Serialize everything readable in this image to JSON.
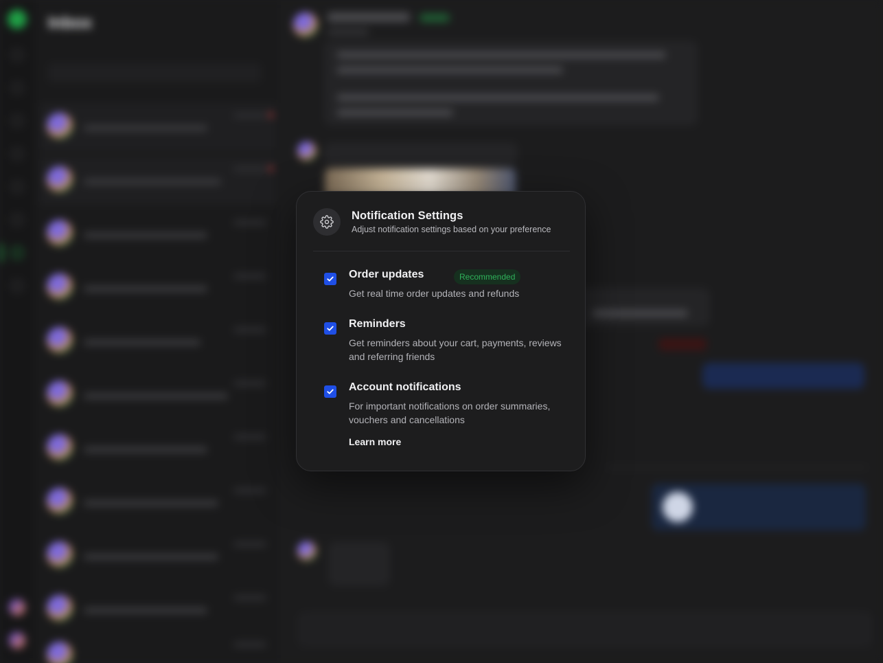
{
  "background": {
    "inbox_title": "Inbox",
    "note": ""
  },
  "modal": {
    "icon": "gear-icon",
    "title": "Notification Settings",
    "subtitle": "Adjust notification settings based on your preference",
    "options": [
      {
        "title": "Order updates",
        "badge": "Recommended",
        "description": "Get real time order updates and refunds",
        "checked": true
      },
      {
        "title": "Reminders",
        "description": "Get reminders about your cart, payments, reviews and referring friends",
        "checked": true
      },
      {
        "title": "Account notifications",
        "description": "For important notifications on order summaries, vouchers and cancellations",
        "checked": true
      }
    ],
    "learn_more": "Learn more"
  },
  "colors": {
    "checkbox": "#1f4fe6",
    "badge_text": "#2fb15a",
    "badge_bg": "#16301f",
    "modal_bg": "#1d1d1e"
  }
}
